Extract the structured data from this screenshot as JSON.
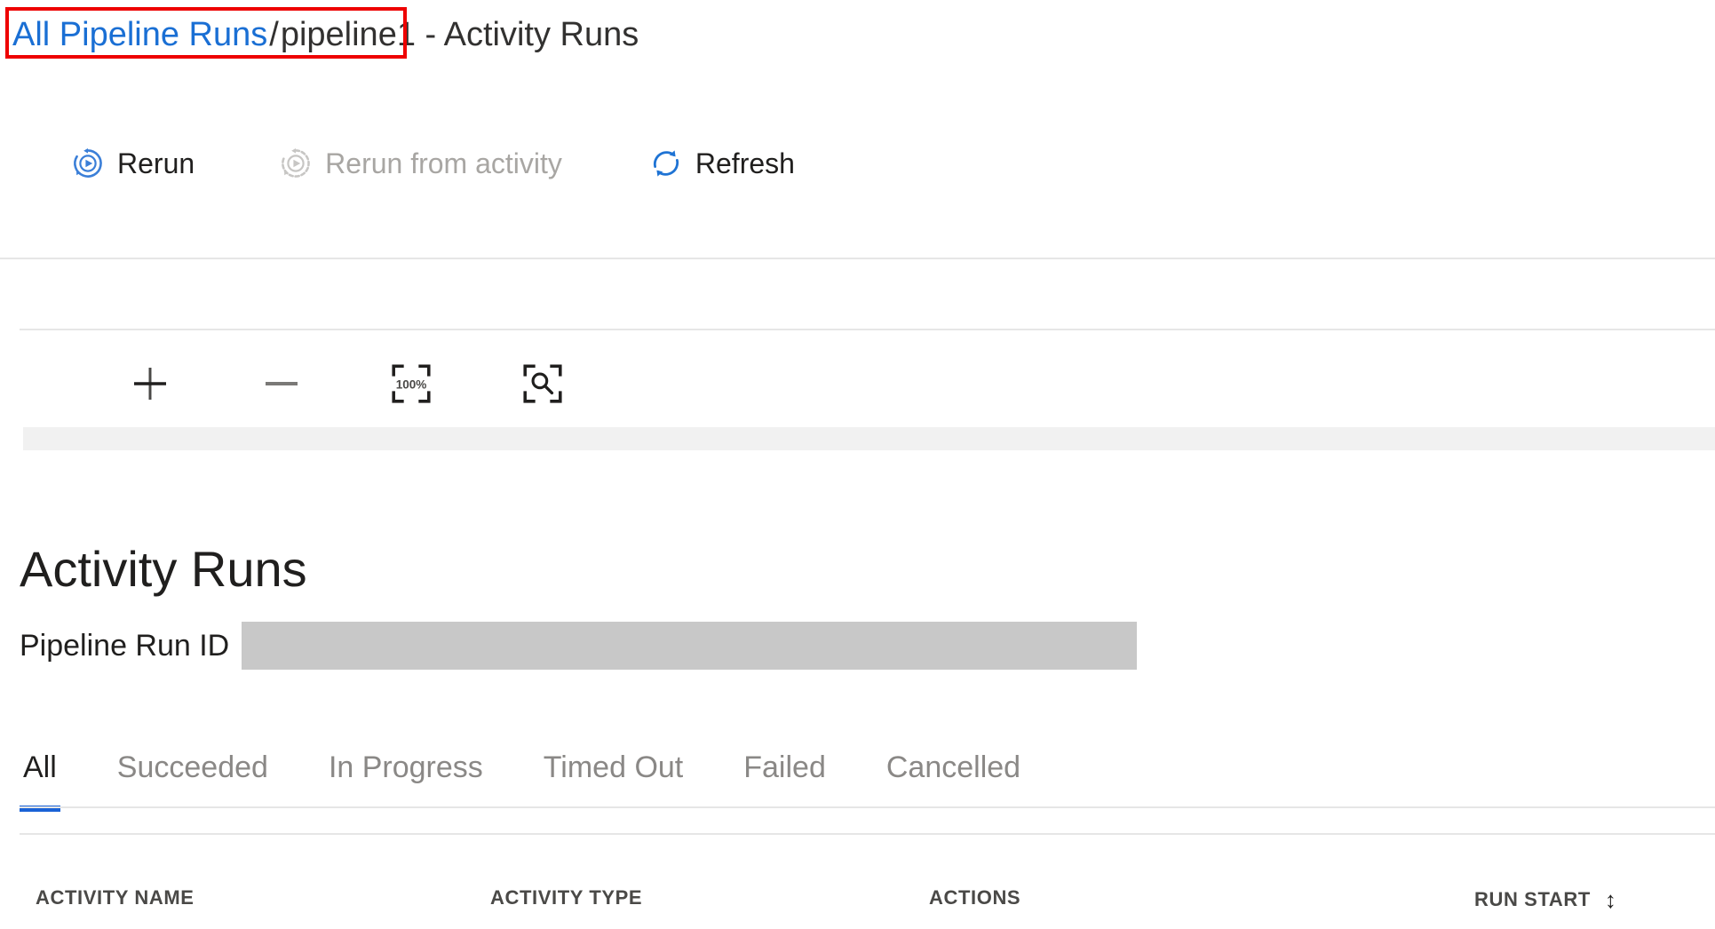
{
  "breadcrumb": {
    "link_label": "All Pipeline Runs",
    "separator": "/",
    "current": "pipeline1 - Activity Runs"
  },
  "annotation": {
    "color": "#ee0000",
    "target": "All Pipeline Runs"
  },
  "colors": {
    "link_blue": "#1a6fd4",
    "accent_blue": "#1a62d6",
    "icon_blue": "#3b7fd8",
    "disabled_grey": "#a8a6a3",
    "rule_grey": "#e6e6e6",
    "band_grey": "#f1f1f1",
    "redaction_grey": "#c8c8c8"
  },
  "commandbar": {
    "buttons": [
      {
        "label": "Rerun",
        "icon": "rerun-icon",
        "disabled": false
      },
      {
        "label": "Rerun from activity",
        "icon": "rerun-from-activity-icon",
        "disabled": true
      },
      {
        "label": "Refresh",
        "icon": "refresh-icon",
        "disabled": false
      }
    ]
  },
  "zoom_toolbar": {
    "buttons": [
      {
        "name": "zoom-in",
        "icon": "plus-icon",
        "label": "+"
      },
      {
        "name": "zoom-out",
        "icon": "minus-icon",
        "label": "—"
      },
      {
        "name": "zoom-to-100",
        "icon": "zoom-100-percent-icon",
        "label": "100%"
      },
      {
        "name": "zoom-to-fit",
        "icon": "zoom-to-fit-icon",
        "label": ""
      }
    ]
  },
  "main": {
    "title": "Activity Runs",
    "run_id": {
      "label": "Pipeline Run ID",
      "value": ""
    },
    "tabs": [
      {
        "label": "All",
        "active": true
      },
      {
        "label": "Succeeded",
        "active": false
      },
      {
        "label": "In Progress",
        "active": false
      },
      {
        "label": "Timed Out",
        "active": false
      },
      {
        "label": "Failed",
        "active": false
      },
      {
        "label": "Cancelled",
        "active": false
      }
    ],
    "table": {
      "columns": [
        {
          "label": "ACTIVITY NAME",
          "sortable": false
        },
        {
          "label": "ACTIVITY TYPE",
          "sortable": false
        },
        {
          "label": "ACTIONS",
          "sortable": false
        },
        {
          "label": "RUN START",
          "sortable": true,
          "sort_glyph": "↕"
        }
      ],
      "rows": []
    }
  }
}
